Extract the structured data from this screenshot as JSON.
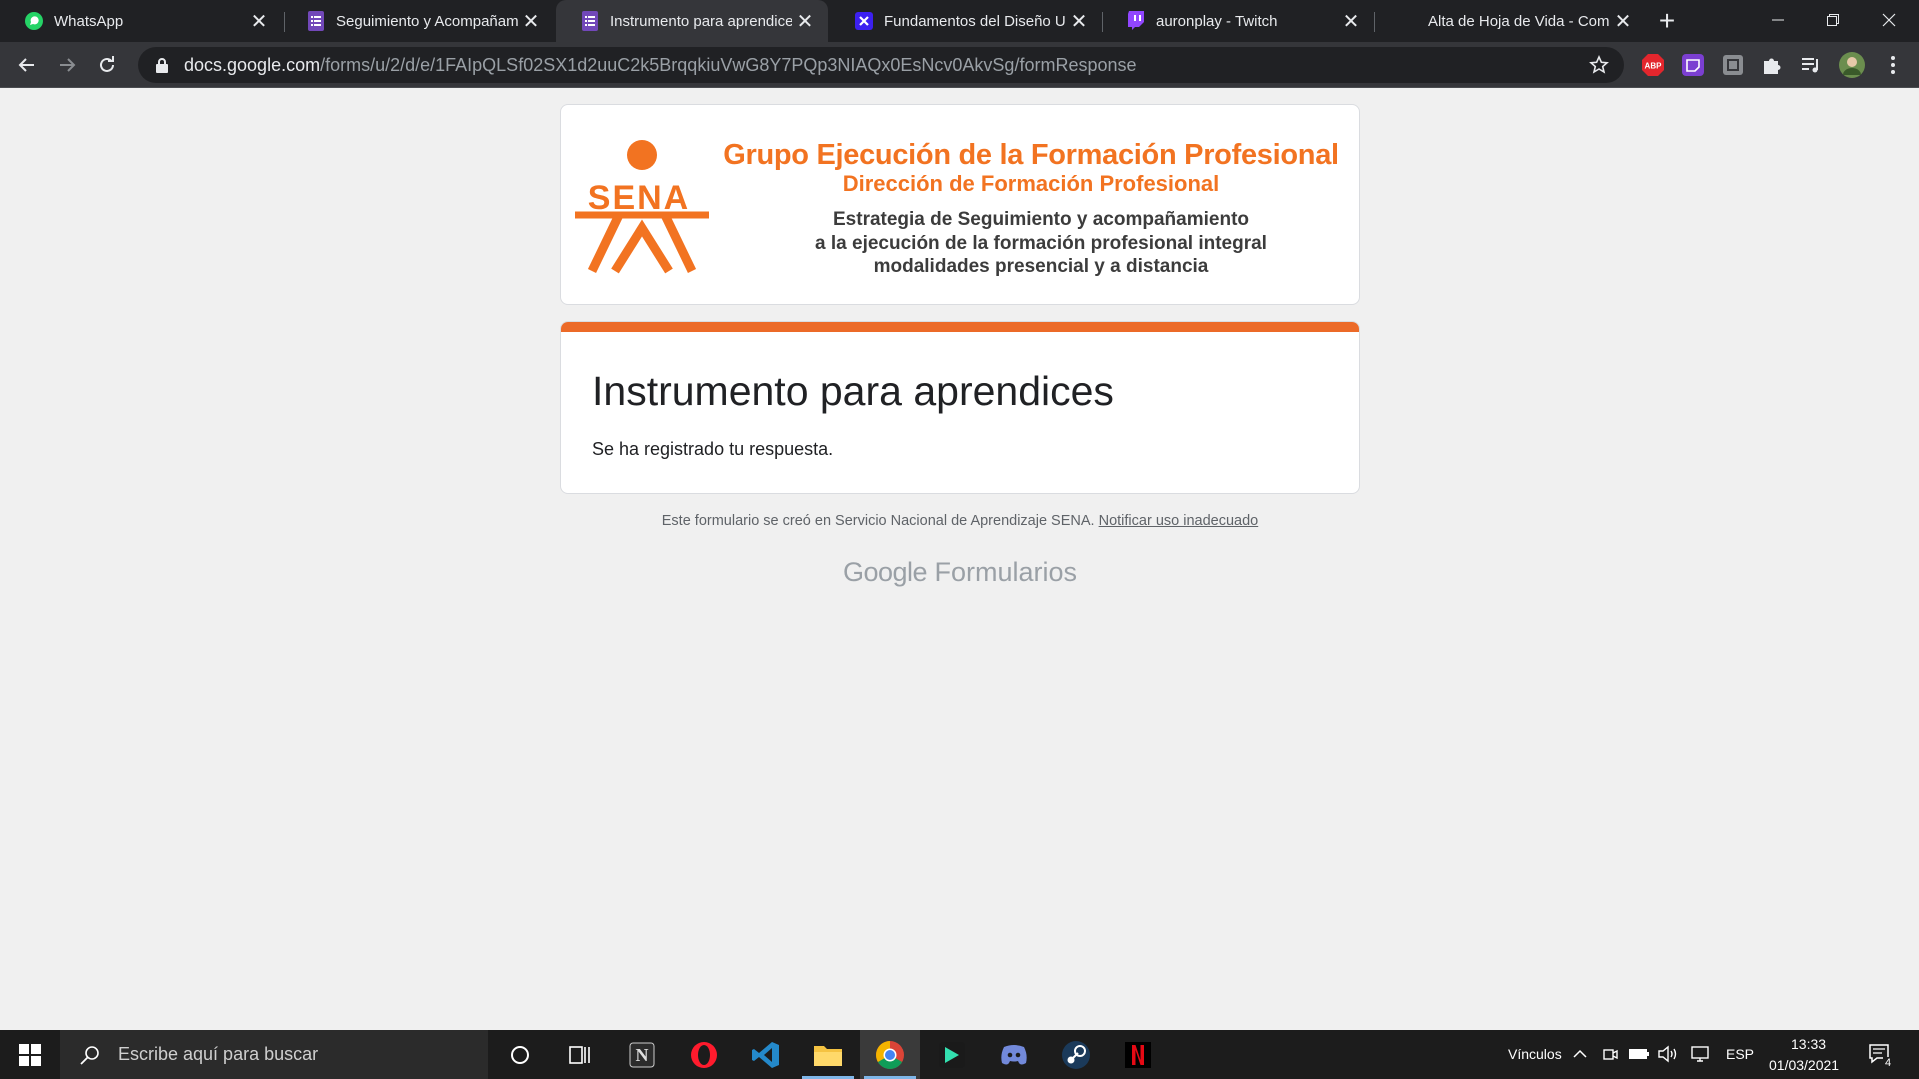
{
  "tabs": [
    {
      "title": "WhatsApp",
      "icon": "whatsapp-icon",
      "active": false
    },
    {
      "title": "Seguimiento y Acompañamiento",
      "icon": "google-forms-icon",
      "active": false
    },
    {
      "title": "Instrumento para aprendices",
      "icon": "google-forms-icon",
      "active": true
    },
    {
      "title": "Fundamentos del Diseño UX",
      "icon": "platzi-icon",
      "active": false
    },
    {
      "title": "auronplay - Twitch",
      "icon": "twitch-icon",
      "active": false
    },
    {
      "title": "Alta de Hoja de Vida - Computrabajo",
      "icon": "blank-icon",
      "active": false
    }
  ],
  "address": {
    "host": "docs.google.com",
    "path": "/forms/u/2/d/e/1FAIpQLSf02SX1d2uuC2k5BrqqkiuVwG8Y7PQp3NIAQx0EsNcv0AkvSg/formResponse"
  },
  "extensions": {
    "adblock_label": "ABP"
  },
  "banner": {
    "logo_text": "SENA",
    "heading": "Grupo Ejecución de la Formación Profesional",
    "subheading": "Dirección de Formación Profesional",
    "line1": "Estrategia de Seguimiento y acompañamiento",
    "line2": "a la ejecución de la formación profesional integral",
    "line3": "modalidades presencial y a distancia"
  },
  "form": {
    "title": "Instrumento para aprendices",
    "confirmation": "Se ha registrado tu respuesta."
  },
  "footer": {
    "note": "Este formulario se creó en Servicio Nacional de Aprendizaje SENA.",
    "report_link": "Notificar uso inadecuado",
    "brand_google": "Google",
    "brand_product": "Formularios"
  },
  "taskbar": {
    "search_placeholder": "Escribe aquí para buscar",
    "links_label": "Vínculos",
    "language": "ESP",
    "time": "13:33",
    "date": "01/03/2021",
    "notifications": "4"
  },
  "colors": {
    "accent_orange": "#ec6a28",
    "sena_orange": "#f27321"
  }
}
